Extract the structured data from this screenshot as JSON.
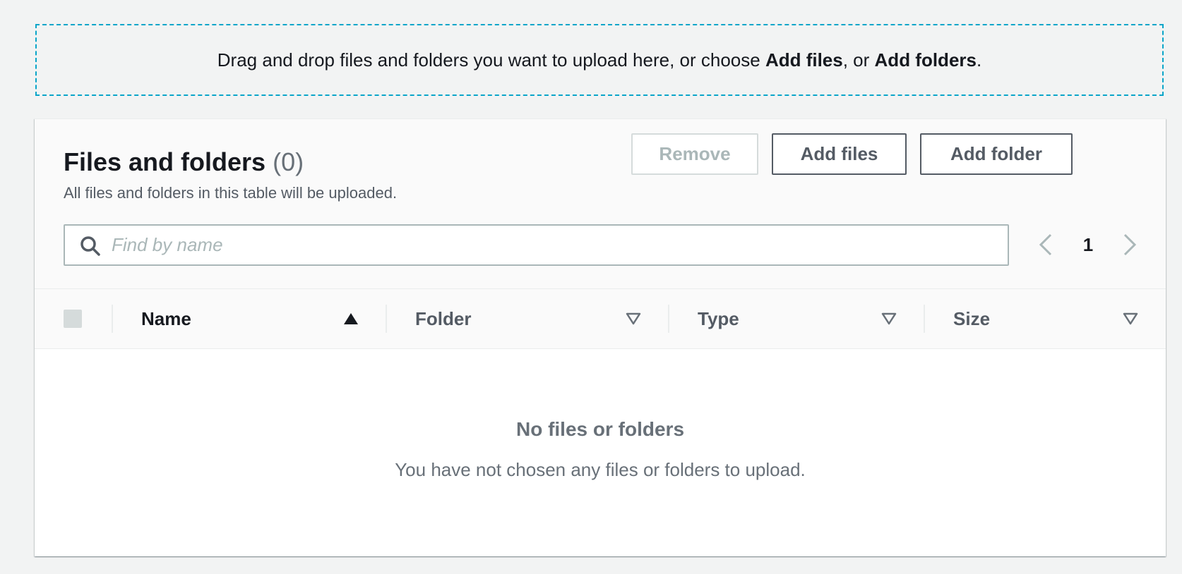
{
  "dropzone": {
    "text_before": "Drag and drop files and folders you want to upload here, or choose ",
    "add_files": "Add files",
    "text_middle": ", or ",
    "add_folders": "Add folders",
    "text_after": "."
  },
  "panel": {
    "title": "Files and folders",
    "count": "(0)",
    "subtitle": "All files and folders in this table will be uploaded.",
    "buttons": {
      "remove": "Remove",
      "add_files": "Add files",
      "add_folder": "Add folder"
    }
  },
  "search": {
    "placeholder": "Find by name",
    "value": ""
  },
  "pagination": {
    "current_page": "1",
    "prev_icon": "chevron-left-icon",
    "next_icon": "chevron-right-icon"
  },
  "table": {
    "columns": [
      {
        "label": "Name",
        "sort": "ascending"
      },
      {
        "label": "Folder",
        "sort": "none"
      },
      {
        "label": "Type",
        "sort": "none"
      },
      {
        "label": "Size",
        "sort": "none"
      }
    ],
    "rows": []
  },
  "empty_state": {
    "title": "No files or folders",
    "text": "You have not chosen any files or folders to upload."
  },
  "colors": {
    "dropzone_border": "#0aa5c9",
    "button_border": "#545b64",
    "disabled": "#aab7b8",
    "muted_text": "#687078"
  }
}
